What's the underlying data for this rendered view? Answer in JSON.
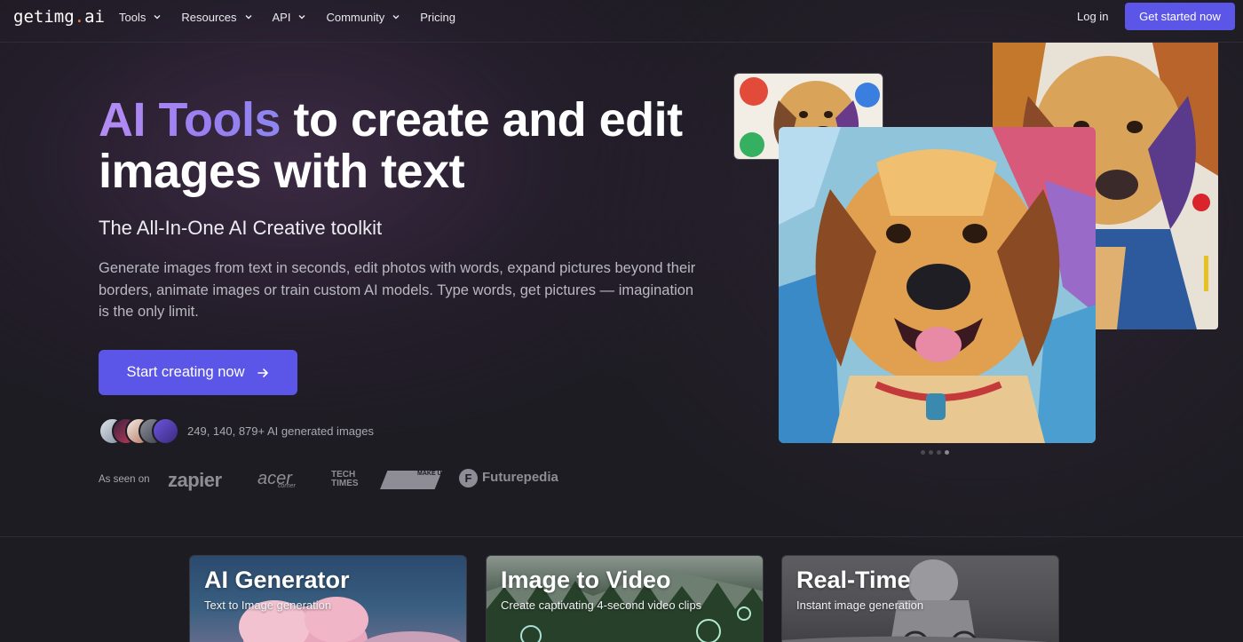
{
  "brand": {
    "logo_main": "getimg",
    "logo_dot": ".",
    "logo_tld": "ai"
  },
  "nav": {
    "items": [
      {
        "label": "Tools",
        "has_dropdown": true
      },
      {
        "label": "Resources",
        "has_dropdown": true
      },
      {
        "label": "API",
        "has_dropdown": true
      },
      {
        "label": "Community",
        "has_dropdown": true
      },
      {
        "label": "Pricing",
        "has_dropdown": false
      }
    ],
    "login": "Log in",
    "cta": "Get started now"
  },
  "hero": {
    "headline_accent": "AI Tools",
    "headline_rest": " to create and edit images with text",
    "subhead": "The All-In-One AI Creative toolkit",
    "description": "Generate images from text in seconds, edit photos with words, expand pictures beyond their borders, animate images or train custom AI models. Type words, get pictures — imagination is the only limit.",
    "cta": "Start creating now",
    "generated_count": "249, 140, 879+ AI generated images",
    "carousel": {
      "slides": 4,
      "active_index": 3
    }
  },
  "as_seen_on": {
    "label": "As seen on",
    "logos": [
      "zapier",
      "acer",
      "TECH TIMES",
      "MAKE USE OF",
      "Futurepedia"
    ],
    "acer_sub": "corner",
    "tech_line1": "TECH",
    "tech_line2": "TIMES",
    "muo_text": "MAKE USE OF."
  },
  "cards": [
    {
      "title": "AI Generator",
      "subtitle": "Text to Image generation"
    },
    {
      "title": "Image to Video",
      "subtitle": "Create captivating 4-second video clips"
    },
    {
      "title": "Real-Time",
      "subtitle": "Instant image generation"
    }
  ],
  "colors": {
    "accent": "#5b55e8",
    "background": "#1d1c22",
    "headline_accent": "#b58cf5",
    "logo_dot": "#f0893a"
  }
}
